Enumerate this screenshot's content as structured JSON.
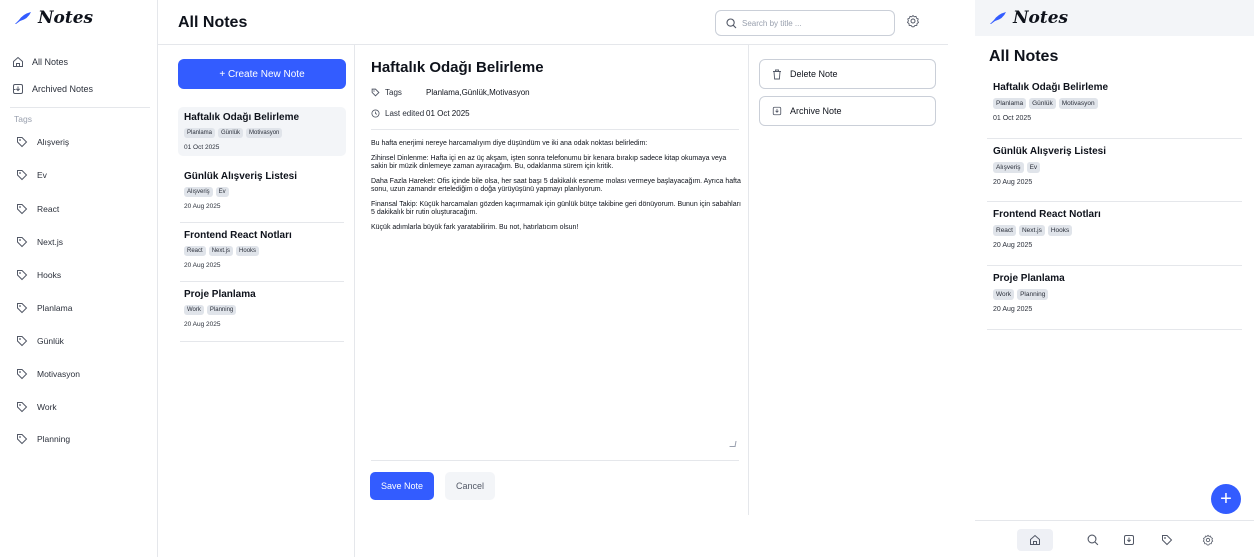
{
  "app": {
    "logo_text": "Notes"
  },
  "sidebar": {
    "nav": [
      {
        "label": "All Notes",
        "icon": "home-icon"
      },
      {
        "label": "Archived Notes",
        "icon": "archive-icon"
      }
    ],
    "tags_heading": "Tags",
    "tags": [
      "Alışveriş",
      "Ev",
      "React",
      "Next.js",
      "Hooks",
      "Planlama",
      "Günlük",
      "Motivasyon",
      "Work",
      "Planning"
    ]
  },
  "header": {
    "title": "All Notes",
    "search_placeholder": "Search by title ..."
  },
  "notes_list": {
    "create_label": "+ Create New Note",
    "notes": [
      {
        "title": "Haftalık Odağı Belirleme",
        "tags": [
          "Planlama",
          "Günlük",
          "Motivasyon"
        ],
        "date": "01 Oct 2025"
      },
      {
        "title": "Günlük Alışveriş Listesi",
        "tags": [
          "Alışveriş",
          "Ev"
        ],
        "date": "20 Aug 2025"
      },
      {
        "title": "Frontend React Notları",
        "tags": [
          "React",
          "Next.js",
          "Hooks"
        ],
        "date": "20 Aug 2025"
      },
      {
        "title": "Proje Planlama",
        "tags": [
          "Work",
          "Planning"
        ],
        "date": "20 Aug 2025"
      }
    ]
  },
  "editor": {
    "title": "Haftalık Odağı Belirleme",
    "tags_label": "Tags",
    "tags_value": "Planlama,Günlük,Motivasyon",
    "edited_label": "Last edited",
    "edited_value": "01 Oct 2025",
    "body": [
      "Bu hafta enerjimi nereye harcamalıyım diye düşündüm ve iki ana odak noktası belirledim:",
      "Zihinsel Dinlenme: Hafta içi en az üç akşam, işten sonra telefonumu bir kenara bırakıp sadece kitap okumaya veya sakin bir müzik dinlemeye zaman ayıracağım. Bu, odaklanma sürem için kritik.",
      "Daha Fazla Hareket: Ofis içinde bile olsa, her saat başı 5 dakikalık esneme molası vermeye başlayacağım. Ayrıca hafta sonu, uzun zamandır ertelediğim o doğa yürüyüşünü yapmayı planlıyorum.",
      "Finansal Takip: Küçük harcamaları gözden kaçırmamak için günlük bütçe takibine geri dönüyorum. Bunun için sabahları 5 dakikalık bir rutin oluşturacağım.",
      "Küçük adımlarla büyük fark yaratabilirim. Bu not, hatırlatıcım olsun!"
    ],
    "save_label": "Save Note",
    "cancel_label": "Cancel"
  },
  "actions": {
    "delete_label": "Delete Note",
    "archive_label": "Archive Note"
  },
  "mobile": {
    "logo_text": "Notes",
    "title": "All Notes",
    "fab_label": "+",
    "bottom_tabs": [
      "home-icon",
      "search-icon",
      "archive-icon",
      "tag-icon",
      "settings-icon"
    ]
  },
  "colors": {
    "primary": "#335cff",
    "text": "#0e121b",
    "border": "#e5e7eb",
    "active_bg": "#f3f5f8",
    "chip_bg": "#e0e4ea"
  }
}
